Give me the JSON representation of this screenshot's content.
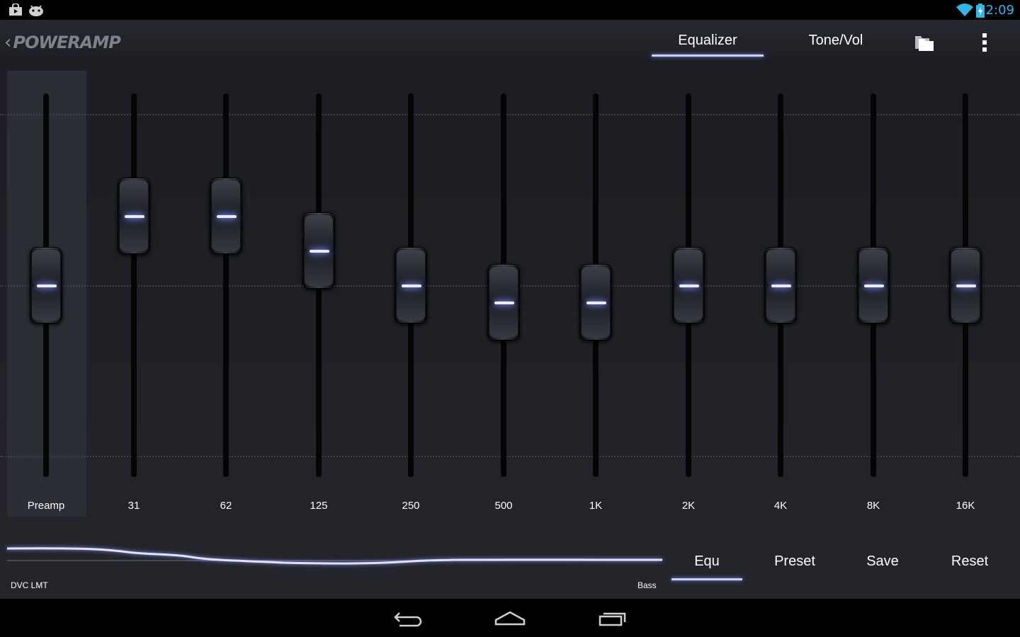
{
  "status_bar": {
    "time": "2:09",
    "left_icons": [
      "shopping-bag-icon",
      "android-icon"
    ],
    "right_icons": [
      "wifi-icon",
      "battery-charging-icon"
    ]
  },
  "app_bar": {
    "logo": "Poweramp",
    "back_icon": "chevron-left-icon",
    "tabs": [
      {
        "label": "Equalizer",
        "active": true
      },
      {
        "label": "Tone/Vol",
        "active": false
      }
    ],
    "folder_icon": "folder-icon",
    "overflow_icon": "overflow-menu-icon"
  },
  "equalizer": {
    "bands": [
      {
        "label": "Preamp",
        "level": 0.5
      },
      {
        "label": "31",
        "level": 0.68
      },
      {
        "label": "62",
        "level": 0.68
      },
      {
        "label": "125",
        "level": 0.59
      },
      {
        "label": "250",
        "level": 0.5
      },
      {
        "label": "500",
        "level": 0.455
      },
      {
        "label": "1K",
        "level": 0.455
      },
      {
        "label": "2K",
        "level": 0.5
      },
      {
        "label": "4K",
        "level": 0.5
      },
      {
        "label": "8K",
        "level": 0.5
      },
      {
        "label": "16K",
        "level": 0.5
      }
    ],
    "accent_color": "#c7d0ff"
  },
  "bottom_panel": {
    "left_label": "DVC LMT",
    "right_label": "Bass",
    "tabs": [
      {
        "label": "Equ",
        "active": true
      },
      {
        "label": "Preset",
        "active": false
      },
      {
        "label": "Save",
        "active": false
      },
      {
        "label": "Reset",
        "active": false
      }
    ]
  },
  "nav_bar": {
    "icons": [
      "back-icon",
      "home-icon",
      "recent-apps-icon"
    ]
  }
}
